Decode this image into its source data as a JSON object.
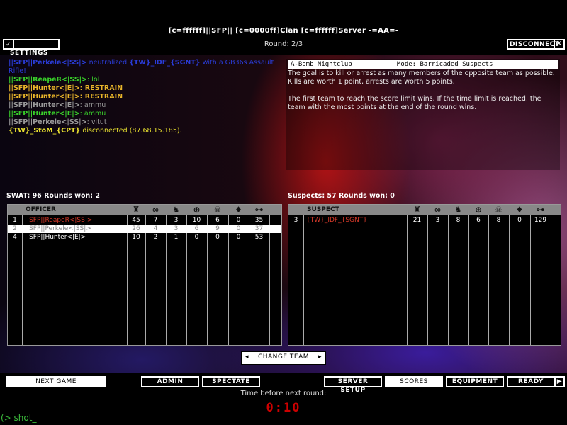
{
  "header": {
    "title": "[c=ffffff]||SFP|| [c=0000ff]Clan [c=ffffff]Server -=AA=-",
    "round": "Round: 2/3",
    "settings_label": "SETTINGS",
    "disconnect_label": "DISCONNECT"
  },
  "chat": [
    {
      "name": "||SFP||Perkele<|SS|>",
      "name_color": "#2a3cd8",
      "text": " neutralized ",
      "text_color": "#2a3cd8",
      "extra": "{TW}_IDF_{SGNT}",
      "extra_color": "#2a3cd8",
      "tail": " with a GB36s Assault Rifle!"
    },
    {
      "name": "||SFP||ReapeR<|SS|>",
      "name_color": "#39d12a",
      "text": ": lol",
      "text_color": "#39d12a"
    },
    {
      "name": "||SFP||Hunter<|E|>",
      "name_color": "#e8b52a",
      "text": ": RESTRAIN",
      "text_color": "#e8b52a",
      "bold": true
    },
    {
      "name": "||SFP||Hunter<|E|>",
      "name_color": "#e8b52a",
      "text": ": RESTRAIN",
      "text_color": "#e8b52a",
      "bold": true
    },
    {
      "name": "||SFP||Hunter<|E|>",
      "name_color": "#9a9a9a",
      "text": ": ammu",
      "text_color": "#9a9a9a"
    },
    {
      "name": "||SFP||Hunter<|E|>",
      "name_color": "#39d12a",
      "text": ": ammu",
      "text_color": "#39d12a"
    },
    {
      "name": "||SFP||Perkele<|SS|>",
      "name_color": "#9a9a9a",
      "text": ": vitut",
      "text_color": "#9a9a9a"
    },
    {
      "name": "{TW}_StoM_{CPT}",
      "name_color": "#e8e030",
      "text": " disconnected (87.68.15.185).",
      "text_color": "#e8e030"
    }
  ],
  "info": {
    "map": "A-Bomb Nightclub",
    "mode": "Mode: Barricaded Suspects",
    "para1": "The goal is to kill or arrest as many members of the opposite team as possible.  Kills are worth 1 point, arrests are worth 5 points.",
    "para2": "The first team to reach the score limit wins.  If the time limit is reached, the team with the most points at the end of the round wins."
  },
  "stat_icons": [
    "trophy-icon",
    "handcuffs-icon",
    "arrested-icon",
    "crosshair-icon",
    "skull-icon",
    "medal-icon",
    "ping-icon"
  ],
  "swat": {
    "summary": "SWAT: 96    Rounds won: 2",
    "column_header": "OFFICER",
    "rows": [
      {
        "num": "1",
        "name": "||SFP||ReapeR<|SS|>",
        "name_color": "#d83a2a",
        "stats": [
          "45",
          "7",
          "3",
          "10",
          "6",
          "0",
          "35"
        ],
        "selected": false
      },
      {
        "num": "2",
        "name": "||SFP||Perkele<|SS|>",
        "name_color": "#888888",
        "stats": [
          "26",
          "4",
          "3",
          "6",
          "9",
          "0",
          "37"
        ],
        "selected": true
      },
      {
        "num": "4",
        "name": "||SFP||Hunter<|E|>",
        "name_color": "#ffffff",
        "stats": [
          "10",
          "2",
          "1",
          "0",
          "0",
          "0",
          "53"
        ],
        "selected": false
      }
    ]
  },
  "suspects": {
    "summary": "Suspects: 57    Rounds won: 0",
    "column_header": "SUSPECT",
    "rows": [
      {
        "num": "3",
        "name": "{TW}_IDF_{SGNT}",
        "name_color": "#d83a2a",
        "stats": [
          "21",
          "3",
          "8",
          "6",
          "8",
          "0",
          "129"
        ],
        "selected": false
      }
    ]
  },
  "footer": {
    "change_team": "CHANGE TEAM",
    "next_game": "NEXT GAME",
    "admin": "ADMIN",
    "spectate": "SPECTATE",
    "server_setup": "SERVER SETUP",
    "scores": "SCORES",
    "equipment": "EQUIPMENT",
    "ready": "READY",
    "time_label": "Time before next round:",
    "timer": "0:10",
    "console": "(> shot_"
  }
}
